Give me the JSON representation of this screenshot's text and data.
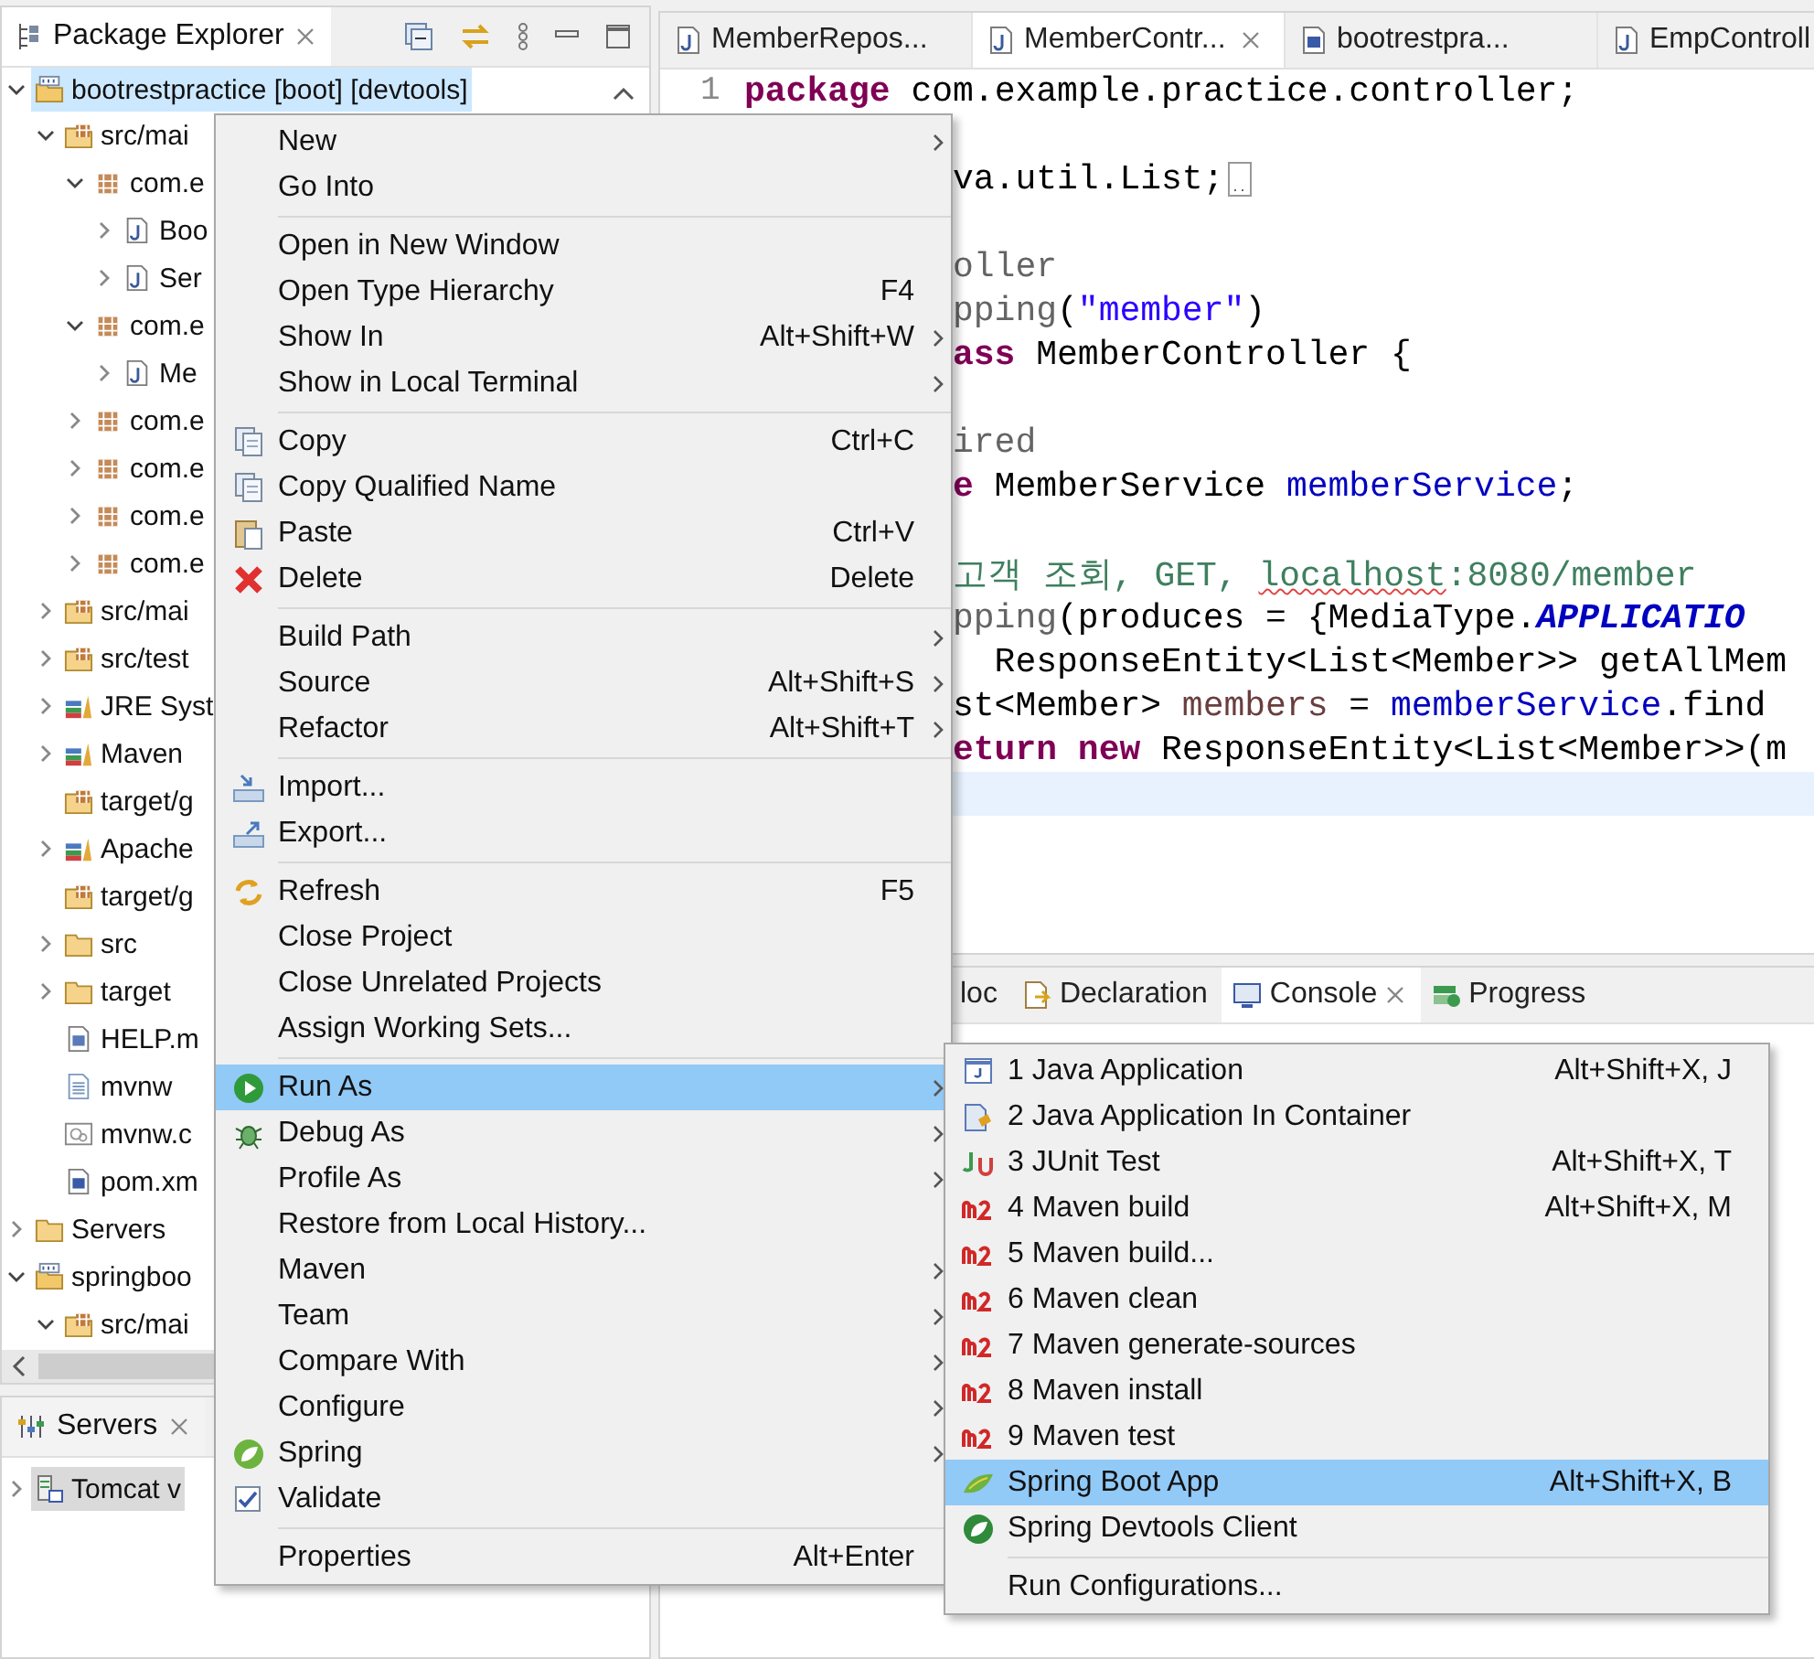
{
  "explorer": {
    "title": "Package Explorer",
    "tree": [
      {
        "label": "bootrestpractice [boot] [devtools]",
        "kind": "project",
        "selected": true,
        "expanded": true,
        "children": [
          {
            "label": "src/mai",
            "kind": "source-folder",
            "selected": false,
            "expanded": true,
            "children": [
              {
                "label": "com.e",
                "kind": "package",
                "selected": false,
                "expanded": true,
                "children": [
                  {
                    "label": "Boo",
                    "kind": "java-file",
                    "selected": false,
                    "expanded": false
                  },
                  {
                    "label": "Ser",
                    "kind": "java-file",
                    "selected": false,
                    "expanded": false
                  }
                ]
              },
              {
                "label": "com.e",
                "kind": "package",
                "selected": false,
                "expanded": true,
                "children": [
                  {
                    "label": "Me",
                    "kind": "java-file",
                    "selected": false,
                    "expanded": false
                  }
                ]
              },
              {
                "label": "com.e",
                "kind": "package",
                "selected": false,
                "expanded": false
              },
              {
                "label": "com.e",
                "kind": "package",
                "selected": false,
                "expanded": false
              },
              {
                "label": "com.e",
                "kind": "package",
                "selected": false,
                "expanded": false
              },
              {
                "label": "com.e",
                "kind": "package",
                "selected": false,
                "expanded": false
              }
            ]
          },
          {
            "label": "src/mai",
            "kind": "source-folder",
            "selected": false,
            "expanded": false
          },
          {
            "label": "src/test",
            "kind": "source-folder",
            "selected": false,
            "expanded": false
          },
          {
            "label": "JRE Syst",
            "kind": "library",
            "selected": false,
            "expanded": false
          },
          {
            "label": "Maven",
            "kind": "library",
            "selected": false,
            "expanded": false
          },
          {
            "label": "target/g",
            "kind": "source-folder",
            "selected": false
          },
          {
            "label": "Apache",
            "kind": "library",
            "selected": false,
            "expanded": false
          },
          {
            "label": "target/g",
            "kind": "source-folder",
            "selected": false
          },
          {
            "label": "src",
            "kind": "folder",
            "selected": false,
            "expanded": false
          },
          {
            "label": "target",
            "kind": "folder",
            "selected": false,
            "expanded": false
          },
          {
            "label": "HELP.m",
            "kind": "doc-file",
            "selected": false
          },
          {
            "label": "mvnw",
            "kind": "text-file",
            "selected": false
          },
          {
            "label": "mvnw.c",
            "kind": "cmd-file",
            "selected": false
          },
          {
            "label": "pom.xm",
            "kind": "pom-file",
            "selected": false
          }
        ]
      },
      {
        "label": "Servers",
        "kind": "folder",
        "selected": false,
        "expanded": false
      },
      {
        "label": "springboo",
        "kind": "project",
        "selected": false,
        "expanded": true,
        "children": [
          {
            "label": "src/mai",
            "kind": "source-folder",
            "selected": false,
            "expanded": true
          }
        ]
      }
    ]
  },
  "servers": {
    "title": "Servers",
    "items": [
      {
        "label": "Tomcat v",
        "expanded": false,
        "selected": true
      }
    ]
  },
  "editor": {
    "tabs": [
      {
        "label": "MemberRepos...",
        "kind": "java",
        "selected": false
      },
      {
        "label": "MemberContr...",
        "kind": "java",
        "selected": true
      },
      {
        "label": "bootrestpra...",
        "kind": "maven",
        "selected": false
      },
      {
        "label": "EmpControll",
        "kind": "java",
        "selected": false
      }
    ],
    "lines": [
      {
        "number": "1",
        "tokens": [
          {
            "kind": "keyword",
            "text": "package"
          },
          {
            "kind": "plain",
            "text": " com.example.practice.controller;"
          }
        ]
      },
      {
        "space_before": true,
        "folded": true,
        "tokens": [
          {
            "kind": "plain",
            "text": "va.util.List;"
          }
        ]
      },
      {
        "space_before": true,
        "tokens": [
          {
            "kind": "annotation",
            "text": "oller"
          }
        ]
      },
      {
        "tokens": [
          {
            "kind": "annotation",
            "text": "pping"
          },
          {
            "kind": "plain",
            "text": "("
          },
          {
            "kind": "string",
            "text": "\"member\""
          },
          {
            "kind": "plain",
            "text": ")"
          }
        ]
      },
      {
        "tokens": [
          {
            "kind": "keyword",
            "text": "ass"
          },
          {
            "kind": "plain",
            "text": " MemberController {"
          }
        ]
      },
      {
        "space_before": true,
        "tokens": [
          {
            "kind": "annotation",
            "text": "ired"
          }
        ]
      },
      {
        "tokens": [
          {
            "kind": "keyword",
            "text": "e"
          },
          {
            "kind": "plain",
            "text": " MemberService "
          },
          {
            "kind": "field",
            "text": "memberService"
          },
          {
            "kind": "plain",
            "text": ";"
          }
        ]
      },
      {
        "space_before": true,
        "tokens": [
          {
            "kind": "comment",
            "text": "고객 조회, GET, "
          },
          {
            "kind": "comment-flagged",
            "text": "localhost"
          },
          {
            "kind": "comment",
            "text": ":8080/member"
          }
        ]
      },
      {
        "tokens": [
          {
            "kind": "annotation",
            "text": "pping"
          },
          {
            "kind": "plain",
            "text": "(produces = {MediaType."
          },
          {
            "kind": "static",
            "text": "APPLICATIO"
          }
        ]
      },
      {
        "tokens": [
          {
            "kind": "plain",
            "text": "  ResponseEntity<List<Member>> getAllMem"
          }
        ]
      },
      {
        "tokens": [
          {
            "kind": "plain",
            "text": "st<Member> "
          },
          {
            "kind": "local",
            "text": "members"
          },
          {
            "kind": "plain",
            "text": " = "
          },
          {
            "kind": "field",
            "text": "memberService"
          },
          {
            "kind": "plain",
            "text": ".find"
          }
        ]
      },
      {
        "tokens": [
          {
            "kind": "keyword",
            "text": "eturn"
          },
          {
            "kind": "keyword",
            "text": " new"
          },
          {
            "kind": "plain",
            "text": " ResponseEntity<List<Member>>(m"
          }
        ]
      },
      {
        "current": true
      }
    ]
  },
  "console": {
    "tabs": [
      {
        "label": "loc",
        "kind": "plain",
        "selected": false
      },
      {
        "label": "Declaration",
        "kind": "declaration",
        "selected": false
      },
      {
        "label": "Console",
        "kind": "console",
        "selected": true
      },
      {
        "label": "Progress",
        "kind": "progress",
        "selected": false
      }
    ]
  },
  "context_menu": {
    "items": [
      {
        "kind": "plain",
        "label": "New",
        "submenu": true,
        "selected": false
      },
      {
        "kind": "plain",
        "label": "Go Into",
        "selected": false
      },
      {
        "kind": "separator"
      },
      {
        "kind": "plain",
        "label": "Open in New Window",
        "selected": false
      },
      {
        "kind": "plain",
        "label": "Open Type Hierarchy",
        "shortcut": "F4",
        "selected": false
      },
      {
        "kind": "plain",
        "label": "Show In",
        "shortcut": "Alt+Shift+W",
        "submenu": true,
        "selected": false
      },
      {
        "kind": "plain",
        "label": "Show in Local Terminal",
        "submenu": true,
        "selected": false
      },
      {
        "kind": "separator"
      },
      {
        "kind": "copy",
        "label": "Copy",
        "shortcut": "Ctrl+C",
        "selected": false
      },
      {
        "kind": "copy",
        "label": "Copy Qualified Name",
        "selected": false
      },
      {
        "kind": "paste",
        "label": "Paste",
        "shortcut": "Ctrl+V",
        "selected": false
      },
      {
        "kind": "delete",
        "label": "Delete",
        "shortcut": "Delete",
        "selected": false
      },
      {
        "kind": "separator"
      },
      {
        "kind": "plain",
        "label": "Build Path",
        "submenu": true,
        "selected": false
      },
      {
        "kind": "plain",
        "label": "Source",
        "shortcut": "Alt+Shift+S",
        "submenu": true,
        "selected": false
      },
      {
        "kind": "plain",
        "label": "Refactor",
        "shortcut": "Alt+Shift+T",
        "submenu": true,
        "selected": false
      },
      {
        "kind": "separator"
      },
      {
        "kind": "import",
        "label": "Import...",
        "selected": false
      },
      {
        "kind": "export",
        "label": "Export...",
        "selected": false
      },
      {
        "kind": "separator"
      },
      {
        "kind": "refresh",
        "label": "Refresh",
        "shortcut": "F5",
        "selected": false
      },
      {
        "kind": "plain",
        "label": "Close Project",
        "selected": false
      },
      {
        "kind": "plain",
        "label": "Close Unrelated Projects",
        "selected": false
      },
      {
        "kind": "plain",
        "label": "Assign Working Sets...",
        "selected": false
      },
      {
        "kind": "separator"
      },
      {
        "kind": "run",
        "label": "Run As",
        "submenu": true,
        "selected": true
      },
      {
        "kind": "debug",
        "label": "Debug As",
        "submenu": true,
        "selected": false
      },
      {
        "kind": "plain",
        "label": "Profile As",
        "submenu": true,
        "selected": false
      },
      {
        "kind": "plain",
        "label": "Restore from Local History...",
        "selected": false
      },
      {
        "kind": "plain",
        "label": "Maven",
        "submenu": true,
        "selected": false
      },
      {
        "kind": "plain",
        "label": "Team",
        "submenu": true,
        "selected": false
      },
      {
        "kind": "plain",
        "label": "Compare With",
        "submenu": true,
        "selected": false
      },
      {
        "kind": "plain",
        "label": "Configure",
        "submenu": true,
        "selected": false
      },
      {
        "kind": "spring",
        "label": "Spring",
        "submenu": true,
        "selected": false
      },
      {
        "kind": "check",
        "label": "Validate",
        "selected": false
      },
      {
        "kind": "separator"
      },
      {
        "kind": "plain",
        "label": "Properties",
        "shortcut": "Alt+Enter",
        "selected": false
      }
    ]
  },
  "submenu": {
    "items": [
      {
        "kind": "java-app",
        "label": "1 Java Application",
        "shortcut": "Alt+Shift+X, J",
        "selected": false
      },
      {
        "kind": "container",
        "label": "2 Java Application In Container",
        "selected": false
      },
      {
        "kind": "junit",
        "label": "3 JUnit Test",
        "shortcut": "Alt+Shift+X, T",
        "selected": false
      },
      {
        "kind": "maven",
        "label": "4 Maven build",
        "shortcut": "Alt+Shift+X, M",
        "selected": false
      },
      {
        "kind": "maven",
        "label": "5 Maven build...",
        "selected": false
      },
      {
        "kind": "maven",
        "label": "6 Maven clean",
        "selected": false
      },
      {
        "kind": "maven",
        "label": "7 Maven generate-sources",
        "selected": false
      },
      {
        "kind": "maven",
        "label": "8 Maven install",
        "selected": false
      },
      {
        "kind": "maven",
        "label": "9 Maven test",
        "selected": false
      },
      {
        "kind": "boot",
        "label": "Spring Boot App",
        "shortcut": "Alt+Shift+X, B",
        "selected": true
      },
      {
        "kind": "devtools",
        "label": "Spring Devtools Client",
        "selected": false
      },
      {
        "kind": "separator"
      },
      {
        "kind": "plain",
        "label": "Run Configurations...",
        "selected": false
      }
    ]
  }
}
